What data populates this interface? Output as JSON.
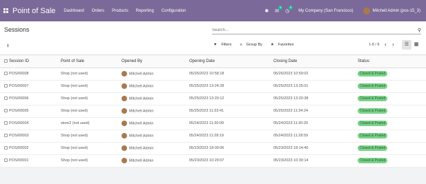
{
  "topbar": {
    "app_title": "Point of Sale",
    "menu": [
      "Dashboard",
      "Orders",
      "Products",
      "Reporting",
      "Configuration"
    ],
    "messages_badge": "5",
    "activity_badge": "5",
    "company": "My Company (San Francisco)",
    "user": "Mitchell Admin (pos-15_3)"
  },
  "breadcrumb": "Sessions",
  "search": {
    "placeholder": "Search..."
  },
  "filters": {
    "filters_label": "Filters",
    "group_by_label": "Group By",
    "favorites_label": "Favorites"
  },
  "pager": "1-8 / 8",
  "table": {
    "headers": [
      "Session ID",
      "Point of Sale",
      "Opened By",
      "Opening Date",
      "Closing Date",
      "Status"
    ],
    "rows": [
      {
        "id": "POS/00008",
        "pos": "Shop (not used)",
        "by": "Mitchell Admin",
        "open": "05/26/2023 10:58:18",
        "close": "05/26/2023 10:59:02",
        "status": "Closed & Posted"
      },
      {
        "id": "POS/00007",
        "pos": "Shop (not used)",
        "by": "Mitchell Admin",
        "open": "05/25/2023 13:24:28",
        "close": "05/25/2023 13:25:01",
        "status": "Closed & Posted"
      },
      {
        "id": "POS/00006",
        "pos": "Shop (not used)",
        "by": "Mitchell Admin",
        "open": "05/25/2023 13:20:12",
        "close": "05/25/2023 13:20:38",
        "status": "Closed & Posted"
      },
      {
        "id": "POS/00005",
        "pos": "Shop (not used)",
        "by": "Mitchell Admin",
        "open": "05/25/2023 11:33:41",
        "close": "05/25/2023 11:34:24",
        "status": "Closed & Posted"
      },
      {
        "id": "POS/00004",
        "pos": "store2 (not used)",
        "by": "Mitchell Admin",
        "open": "05/24/2023 11:30:09",
        "close": "05/24/2023 11:30:20",
        "status": "Closed & Posted"
      },
      {
        "id": "POS/00003",
        "pos": "Shop (not used)",
        "by": "Mitchell Admin",
        "open": "05/24/2023 11:28:19",
        "close": "05/24/2023 11:28:59",
        "status": "Closed & Posted"
      },
      {
        "id": "POS/00002",
        "pos": "Shop (not used)",
        "by": "Mitchell Admin",
        "open": "05/23/2023 18:09:06",
        "close": "05/23/2023 18:14:40",
        "status": "Closed & Posted"
      },
      {
        "id": "POS/00001",
        "pos": "Shop (not used)",
        "by": "Mitchell Admin",
        "open": "05/23/2023 10:29:07",
        "close": "05/23/2023 10:30:14",
        "status": "Closed & Posted"
      }
    ]
  },
  "colors": {
    "topbar": "#7b6a99",
    "status_bg": "#7bd38a",
    "badge": "#21b799"
  }
}
